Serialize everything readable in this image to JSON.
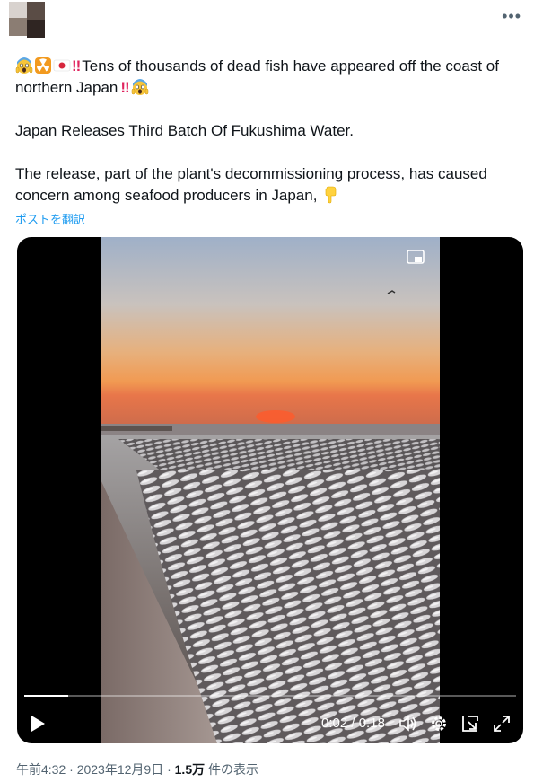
{
  "tweet": {
    "line1_text": "Tens of thousands of dead fish have appeared off the coast of northern Japan",
    "line2_text": "Japan Releases Third Batch Of Fukushima Water.",
    "line3_text": "The release, part of the plant's decommissioning process, has caused concern among seafood producers in Japan,",
    "bang": "‼",
    "translate_label": "ポストを翻訳"
  },
  "video": {
    "time_current": "0:02",
    "time_separator": " / ",
    "time_total": "0:18",
    "progress": 0.09
  },
  "meta": {
    "timestamp": "午前4:32 · 2023年12月9日 · ",
    "views_count": "1.5万",
    "views_label": " 件の表示"
  },
  "icons": [
    "more-icon",
    "scream-emoji-icon",
    "radioactive-emoji-icon",
    "japan-flag-icon",
    "point-down-emoji-icon",
    "pip-icon",
    "play-icon",
    "volume-icon",
    "settings-icon",
    "popout-icon",
    "fullscreen-icon"
  ],
  "colors": {
    "link": "#1d9bf0",
    "text": "#0f1419",
    "muted": "#536471",
    "bang": "#e0245e"
  }
}
